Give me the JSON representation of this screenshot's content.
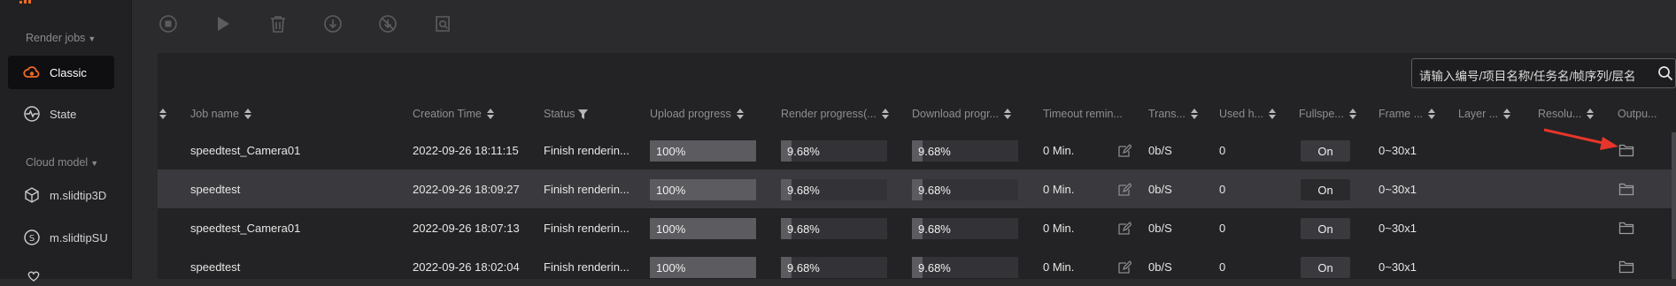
{
  "sidebar": {
    "render_jobs_title": "Render jobs",
    "items_render": [
      {
        "label": "Classic",
        "icon": "cloud-render-icon",
        "active": true
      },
      {
        "label": "State",
        "icon": "state-icon",
        "active": false
      }
    ],
    "cloud_model_title": "Cloud model",
    "items_cloud": [
      {
        "label": "m.slidtip3D",
        "icon": "cube-icon"
      },
      {
        "label": "m.slidtipSU",
        "icon": "sketchup-icon"
      }
    ]
  },
  "toolbar": {
    "buttons": [
      "stop-icon",
      "play-icon",
      "delete-icon",
      "download-icon",
      "download-disabled-icon",
      "view-file-icon"
    ]
  },
  "search": {
    "placeholder": "请输入编号/项目名称/任务名/帧序列/层名"
  },
  "table": {
    "headers": {
      "job_name": "Job name",
      "creation_time": "Creation Time",
      "status": "Status",
      "upload": "Upload progress",
      "render": "Render progress(...",
      "download": "Download progr...",
      "timeout": "Timeout remin...",
      "trans": "Trans...",
      "used": "Used h...",
      "fullspeed": "Fullspe...",
      "frame": "Frame ...",
      "layer": "Layer ...",
      "resolution": "Resolu...",
      "output": "Outpu..."
    },
    "rows": [
      {
        "job_name": "speedtest_Camera01",
        "creation_time": "2022-09-26 18:11:15",
        "status": "Finish renderin...",
        "upload": "100%",
        "upload_pct": 100,
        "render": "9.68%",
        "render_pct": 9.68,
        "download": "9.68%",
        "download_pct": 9.68,
        "timeout": "0 Min.",
        "trans": "0b/S",
        "used": "0",
        "fullspeed": "On",
        "frame": "0~30x1"
      },
      {
        "job_name": "speedtest",
        "creation_time": "2022-09-26 18:09:27",
        "status": "Finish renderin...",
        "upload": "100%",
        "upload_pct": 100,
        "render": "9.68%",
        "render_pct": 9.68,
        "download": "9.68%",
        "download_pct": 9.68,
        "timeout": "0 Min.",
        "trans": "0b/S",
        "used": "0",
        "fullspeed": "On",
        "frame": "0~30x1"
      },
      {
        "job_name": "speedtest_Camera01",
        "creation_time": "2022-09-26 18:07:13",
        "status": "Finish renderin...",
        "upload": "100%",
        "upload_pct": 100,
        "render": "9.68%",
        "render_pct": 9.68,
        "download": "9.68%",
        "download_pct": 9.68,
        "timeout": "0 Min.",
        "trans": "0b/S",
        "used": "0",
        "fullspeed": "On",
        "frame": "0~30x1"
      },
      {
        "job_name": "speedtest",
        "creation_time": "2022-09-26 18:02:04",
        "status": "Finish renderin...",
        "upload": "100%",
        "upload_pct": 100,
        "render": "9.68%",
        "render_pct": 9.68,
        "download": "9.68%",
        "download_pct": 9.68,
        "timeout": "0 Min.",
        "trans": "0b/S",
        "used": "0",
        "fullspeed": "On",
        "frame": "0~30x1"
      }
    ]
  },
  "colors": {
    "accent": "#f26b21",
    "annotation_arrow": "#e8352a",
    "background": "#2b2b2d",
    "sidebar": "#212123"
  }
}
